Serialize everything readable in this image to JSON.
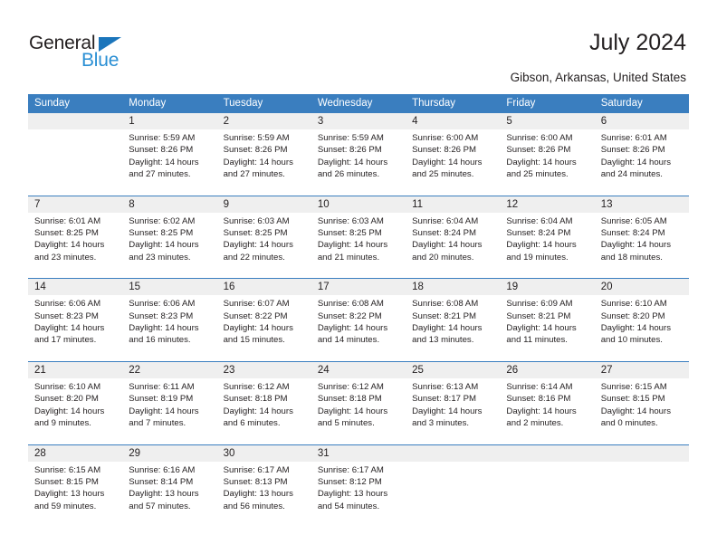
{
  "brand": {
    "name_part1": "General",
    "name_part2": "Blue",
    "triangle_color": "#1b75bb",
    "blue_text_color": "#2a8fd4"
  },
  "header": {
    "title": "July 2024",
    "location": "Gibson, Arkansas, United States"
  },
  "theme": {
    "header_bg": "#3a7ebf",
    "header_text": "#ffffff",
    "daynum_bg": "#efefef",
    "cell_bg": "#ffffff",
    "text": "#231f20"
  },
  "calendar": {
    "weekday_headers": [
      "Sunday",
      "Monday",
      "Tuesday",
      "Wednesday",
      "Thursday",
      "Friday",
      "Saturday"
    ],
    "weeks": [
      {
        "days": [
          {
            "num": "",
            "lines": []
          },
          {
            "num": "1",
            "lines": [
              "Sunrise: 5:59 AM",
              "Sunset: 8:26 PM",
              "Daylight: 14 hours",
              "and 27 minutes."
            ]
          },
          {
            "num": "2",
            "lines": [
              "Sunrise: 5:59 AM",
              "Sunset: 8:26 PM",
              "Daylight: 14 hours",
              "and 27 minutes."
            ]
          },
          {
            "num": "3",
            "lines": [
              "Sunrise: 5:59 AM",
              "Sunset: 8:26 PM",
              "Daylight: 14 hours",
              "and 26 minutes."
            ]
          },
          {
            "num": "4",
            "lines": [
              "Sunrise: 6:00 AM",
              "Sunset: 8:26 PM",
              "Daylight: 14 hours",
              "and 25 minutes."
            ]
          },
          {
            "num": "5",
            "lines": [
              "Sunrise: 6:00 AM",
              "Sunset: 8:26 PM",
              "Daylight: 14 hours",
              "and 25 minutes."
            ]
          },
          {
            "num": "6",
            "lines": [
              "Sunrise: 6:01 AM",
              "Sunset: 8:26 PM",
              "Daylight: 14 hours",
              "and 24 minutes."
            ]
          }
        ]
      },
      {
        "days": [
          {
            "num": "7",
            "lines": [
              "Sunrise: 6:01 AM",
              "Sunset: 8:25 PM",
              "Daylight: 14 hours",
              "and 23 minutes."
            ]
          },
          {
            "num": "8",
            "lines": [
              "Sunrise: 6:02 AM",
              "Sunset: 8:25 PM",
              "Daylight: 14 hours",
              "and 23 minutes."
            ]
          },
          {
            "num": "9",
            "lines": [
              "Sunrise: 6:03 AM",
              "Sunset: 8:25 PM",
              "Daylight: 14 hours",
              "and 22 minutes."
            ]
          },
          {
            "num": "10",
            "lines": [
              "Sunrise: 6:03 AM",
              "Sunset: 8:25 PM",
              "Daylight: 14 hours",
              "and 21 minutes."
            ]
          },
          {
            "num": "11",
            "lines": [
              "Sunrise: 6:04 AM",
              "Sunset: 8:24 PM",
              "Daylight: 14 hours",
              "and 20 minutes."
            ]
          },
          {
            "num": "12",
            "lines": [
              "Sunrise: 6:04 AM",
              "Sunset: 8:24 PM",
              "Daylight: 14 hours",
              "and 19 minutes."
            ]
          },
          {
            "num": "13",
            "lines": [
              "Sunrise: 6:05 AM",
              "Sunset: 8:24 PM",
              "Daylight: 14 hours",
              "and 18 minutes."
            ]
          }
        ]
      },
      {
        "days": [
          {
            "num": "14",
            "lines": [
              "Sunrise: 6:06 AM",
              "Sunset: 8:23 PM",
              "Daylight: 14 hours",
              "and 17 minutes."
            ]
          },
          {
            "num": "15",
            "lines": [
              "Sunrise: 6:06 AM",
              "Sunset: 8:23 PM",
              "Daylight: 14 hours",
              "and 16 minutes."
            ]
          },
          {
            "num": "16",
            "lines": [
              "Sunrise: 6:07 AM",
              "Sunset: 8:22 PM",
              "Daylight: 14 hours",
              "and 15 minutes."
            ]
          },
          {
            "num": "17",
            "lines": [
              "Sunrise: 6:08 AM",
              "Sunset: 8:22 PM",
              "Daylight: 14 hours",
              "and 14 minutes."
            ]
          },
          {
            "num": "18",
            "lines": [
              "Sunrise: 6:08 AM",
              "Sunset: 8:21 PM",
              "Daylight: 14 hours",
              "and 13 minutes."
            ]
          },
          {
            "num": "19",
            "lines": [
              "Sunrise: 6:09 AM",
              "Sunset: 8:21 PM",
              "Daylight: 14 hours",
              "and 11 minutes."
            ]
          },
          {
            "num": "20",
            "lines": [
              "Sunrise: 6:10 AM",
              "Sunset: 8:20 PM",
              "Daylight: 14 hours",
              "and 10 minutes."
            ]
          }
        ]
      },
      {
        "days": [
          {
            "num": "21",
            "lines": [
              "Sunrise: 6:10 AM",
              "Sunset: 8:20 PM",
              "Daylight: 14 hours",
              "and 9 minutes."
            ]
          },
          {
            "num": "22",
            "lines": [
              "Sunrise: 6:11 AM",
              "Sunset: 8:19 PM",
              "Daylight: 14 hours",
              "and 7 minutes."
            ]
          },
          {
            "num": "23",
            "lines": [
              "Sunrise: 6:12 AM",
              "Sunset: 8:18 PM",
              "Daylight: 14 hours",
              "and 6 minutes."
            ]
          },
          {
            "num": "24",
            "lines": [
              "Sunrise: 6:12 AM",
              "Sunset: 8:18 PM",
              "Daylight: 14 hours",
              "and 5 minutes."
            ]
          },
          {
            "num": "25",
            "lines": [
              "Sunrise: 6:13 AM",
              "Sunset: 8:17 PM",
              "Daylight: 14 hours",
              "and 3 minutes."
            ]
          },
          {
            "num": "26",
            "lines": [
              "Sunrise: 6:14 AM",
              "Sunset: 8:16 PM",
              "Daylight: 14 hours",
              "and 2 minutes."
            ]
          },
          {
            "num": "27",
            "lines": [
              "Sunrise: 6:15 AM",
              "Sunset: 8:15 PM",
              "Daylight: 14 hours",
              "and 0 minutes."
            ]
          }
        ]
      },
      {
        "days": [
          {
            "num": "28",
            "lines": [
              "Sunrise: 6:15 AM",
              "Sunset: 8:15 PM",
              "Daylight: 13 hours",
              "and 59 minutes."
            ]
          },
          {
            "num": "29",
            "lines": [
              "Sunrise: 6:16 AM",
              "Sunset: 8:14 PM",
              "Daylight: 13 hours",
              "and 57 minutes."
            ]
          },
          {
            "num": "30",
            "lines": [
              "Sunrise: 6:17 AM",
              "Sunset: 8:13 PM",
              "Daylight: 13 hours",
              "and 56 minutes."
            ]
          },
          {
            "num": "31",
            "lines": [
              "Sunrise: 6:17 AM",
              "Sunset: 8:12 PM",
              "Daylight: 13 hours",
              "and 54 minutes."
            ]
          },
          {
            "num": "",
            "lines": []
          },
          {
            "num": "",
            "lines": []
          },
          {
            "num": "",
            "lines": []
          }
        ]
      }
    ]
  }
}
